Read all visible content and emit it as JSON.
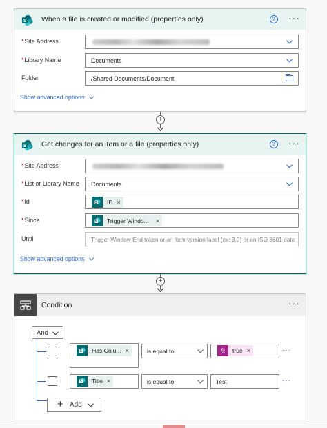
{
  "trigger_card": {
    "title": "When a file is created or modified (properties only)",
    "fields": {
      "site_address_label": "Site Address",
      "library_name_label": "Library Name",
      "library_name_value": "Documents",
      "folder_label": "Folder",
      "folder_value": "/Shared Documents/Document"
    },
    "advanced_label": "Show advanced options"
  },
  "changes_card": {
    "title": "Get changes for an item or a file (properties only)",
    "fields": {
      "site_address_label": "Site Address",
      "list_label": "List or Library Name",
      "list_value": "Documents",
      "id_label": "Id",
      "id_token": "ID",
      "since_label": "Since",
      "since_token": "Trigger Windo...",
      "until_label": "Until",
      "until_placeholder": "Trigger Window End token or an item version label (ex: 3.0) or an ISO 8601 date"
    },
    "advanced_label": "Show advanced options"
  },
  "condition_card": {
    "title": "Condition",
    "group_operator": "And",
    "rows": [
      {
        "left_token": "Has Colu...",
        "operator": "is equal to",
        "right_token": "true"
      },
      {
        "left_token": "Title",
        "operator": "is equal to",
        "right_value": "Test"
      }
    ],
    "add_label": "Add"
  },
  "icons": [
    "sharepoint-icon",
    "help-icon",
    "more-icon",
    "chevron-down-icon",
    "folder-icon",
    "plus-icon",
    "arrow-down-icon",
    "condition-icon",
    "fx-icon",
    "remove-token-icon"
  ],
  "colors": {
    "accent": "#2f6bd8",
    "sharepoint": "#036c70",
    "required": "#c50f1f",
    "selected_border": "#0b6a5d"
  }
}
